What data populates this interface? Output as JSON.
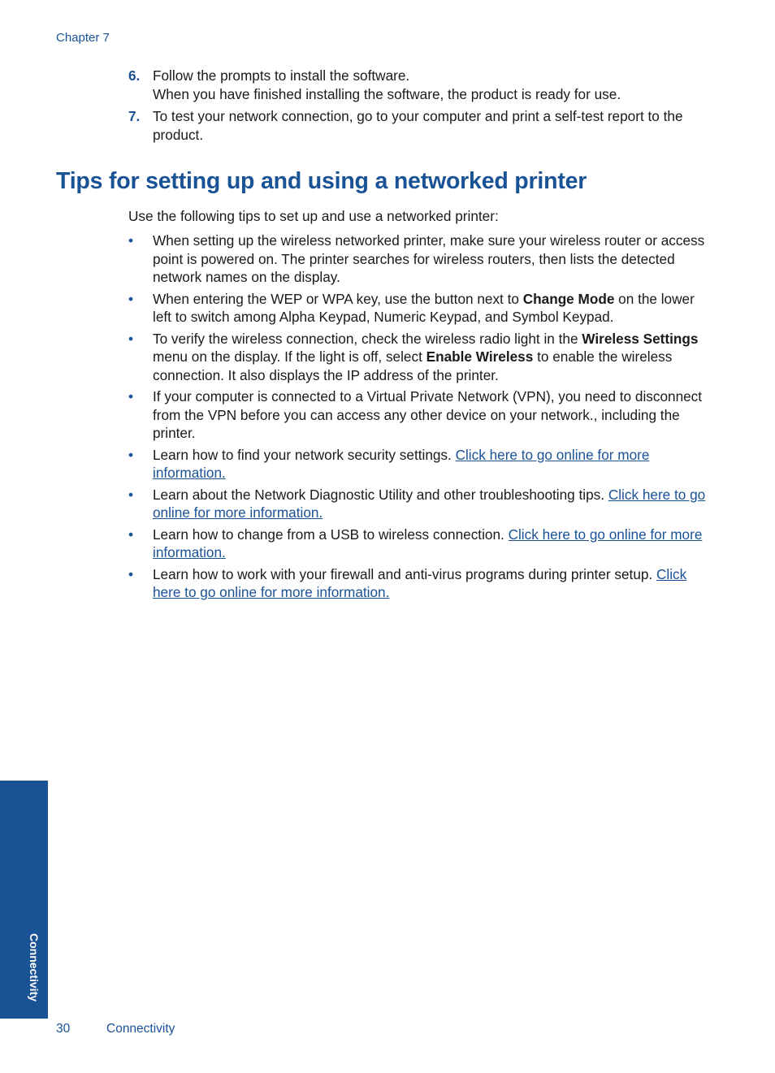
{
  "header": {
    "chapter": "Chapter 7"
  },
  "steps": [
    {
      "num": "6.",
      "lines": [
        "Follow the prompts to install the software.",
        "When you have finished installing the software, the product is ready for use."
      ]
    },
    {
      "num": "7.",
      "lines": [
        "To test your network connection, go to your computer and print a self-test report to the product."
      ]
    }
  ],
  "section": {
    "title": "Tips for setting up and using a networked printer",
    "intro": "Use the following tips to set up and use a networked printer:",
    "bullet": "•",
    "tips": [
      {
        "t1": "When setting up the wireless networked printer, make sure your wireless router or access point is powered on. The printer searches for wireless routers, then lists the detected network names on the display."
      },
      {
        "t1": "When entering the WEP or WPA key, use the button next to ",
        "b1": "Change Mode",
        "t2": " on the lower left to switch among Alpha Keypad, Numeric Keypad, and Symbol Keypad."
      },
      {
        "t1": "To verify the wireless connection, check the wireless radio light in the ",
        "b1": "Wireless Settings",
        "t2": " menu on the display. If the light is off, select ",
        "b2": "Enable Wireless",
        "t3": " to enable the wireless connection. It also displays the IP address of the printer."
      },
      {
        "t1": "If your computer is connected to a Virtual Private Network (VPN), you need to disconnect from the VPN before you can access any other device on your network., including the printer."
      },
      {
        "t1": "Learn how to find your network security settings. ",
        "link": "Click here to go online for more information."
      },
      {
        "t1": "Learn about the Network Diagnostic Utility and other troubleshooting tips. ",
        "link": "Click here to go online for more information."
      },
      {
        "t1": "Learn how to change from a USB to wireless connection. ",
        "link": "Click here to go online for more information."
      },
      {
        "t1": "Learn how to work with your firewall and anti-virus programs during printer setup. ",
        "link": "Click here to go online for more information."
      }
    ]
  },
  "side_tab": {
    "label": "Connectivity"
  },
  "footer": {
    "page_number": "30",
    "section": "Connectivity"
  },
  "colors": {
    "accent": "#1a5296",
    "text": "#1a1a1a"
  }
}
